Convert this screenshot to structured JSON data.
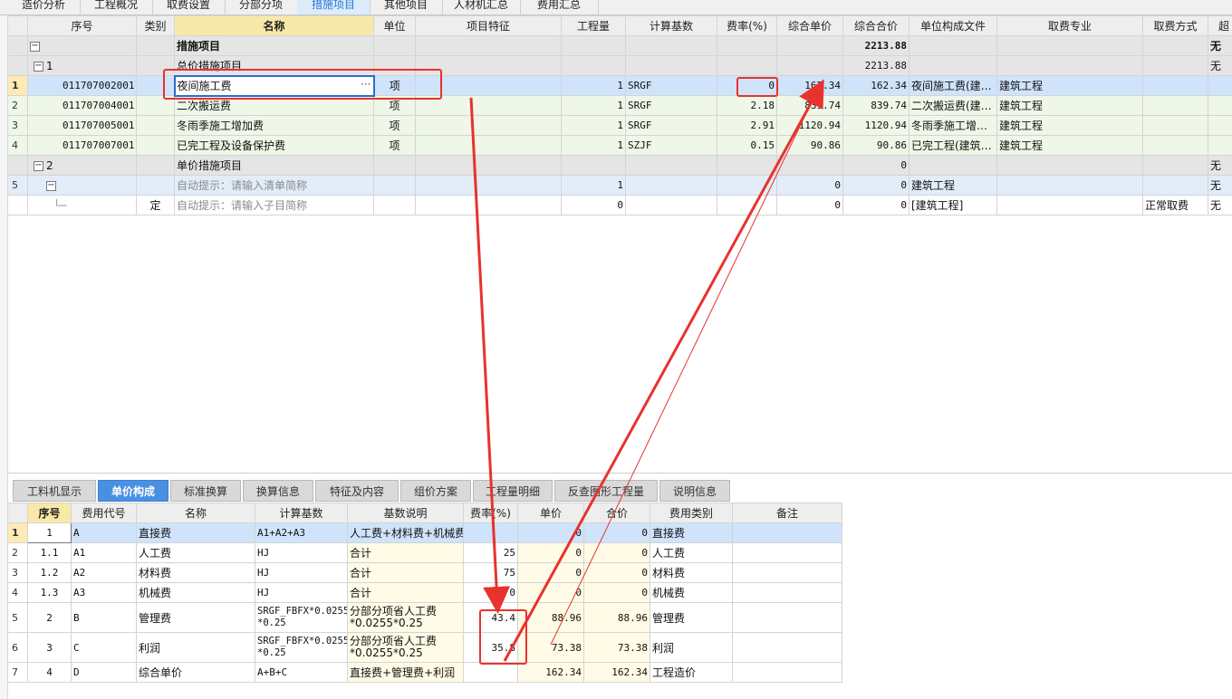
{
  "top_tabs": [
    {
      "label": "造价分析",
      "active": false
    },
    {
      "label": "工程概况",
      "active": false
    },
    {
      "label": "取费设置",
      "active": false
    },
    {
      "label": "分部分项",
      "active": false
    },
    {
      "label": "措施项目",
      "active": true
    },
    {
      "label": "其他项目",
      "active": false
    },
    {
      "label": "人材机汇总",
      "active": false
    },
    {
      "label": "费用汇总",
      "active": false
    }
  ],
  "main_table": {
    "headers": [
      "序号",
      "类别",
      "名称",
      "单位",
      "项目特征",
      "工程量",
      "计算基数",
      "费率(%)",
      "综合单价",
      "综合合价",
      "单位构成文件",
      "取费专业",
      "取费方式",
      "超"
    ],
    "rows": [
      {
        "rownum": "",
        "code": "",
        "type": "",
        "name": "措施项目",
        "unit": "",
        "feature": "",
        "qty": "",
        "base": "",
        "rate": "",
        "price": "",
        "total": "2213.88",
        "file": "",
        "major": "",
        "method": "",
        "extra": "无"
      },
      {
        "rownum": "",
        "code": "1",
        "type": "",
        "name": "总价措施项目",
        "unit": "",
        "feature": "",
        "qty": "",
        "base": "",
        "rate": "",
        "price": "",
        "total": "2213.88",
        "file": "",
        "major": "",
        "method": "",
        "extra": "无"
      },
      {
        "rownum": "1",
        "code": "011707002001",
        "type": "",
        "name": "夜间施工费",
        "unit": "项",
        "feature": "",
        "qty": "1",
        "base": "SRGF",
        "rate": "0",
        "price": "162.34",
        "total": "162.34",
        "file": "夜间施工费(建…",
        "major": "建筑工程",
        "method": "",
        "extra": ""
      },
      {
        "rownum": "2",
        "code": "011707004001",
        "type": "",
        "name": "二次搬运费",
        "unit": "项",
        "feature": "",
        "qty": "1",
        "base": "SRGF",
        "rate": "2.18",
        "price": "839.74",
        "total": "839.74",
        "file": "二次搬运费(建…",
        "major": "建筑工程",
        "method": "",
        "extra": ""
      },
      {
        "rownum": "3",
        "code": "011707005001",
        "type": "",
        "name": "冬雨季施工增加费",
        "unit": "项",
        "feature": "",
        "qty": "1",
        "base": "SRGF",
        "rate": "2.91",
        "price": "1120.94",
        "total": "1120.94",
        "file": "冬雨季施工增…",
        "major": "建筑工程",
        "method": "",
        "extra": ""
      },
      {
        "rownum": "4",
        "code": "011707007001",
        "type": "",
        "name": "已完工程及设备保护费",
        "unit": "项",
        "feature": "",
        "qty": "1",
        "base": "SZJF",
        "rate": "0.15",
        "price": "90.86",
        "total": "90.86",
        "file": "已完工程(建筑…",
        "major": "建筑工程",
        "method": "",
        "extra": ""
      },
      {
        "rownum": "",
        "code": "2",
        "type": "",
        "name": "单价措施项目",
        "unit": "",
        "feature": "",
        "qty": "",
        "base": "",
        "rate": "",
        "price": "",
        "total": "0",
        "file": "",
        "major": "",
        "method": "",
        "extra": "无"
      },
      {
        "rownum": "5",
        "code": "",
        "type": "",
        "name": "自动提示：请输入清单简称",
        "unit": "",
        "feature": "",
        "qty": "1",
        "base": "",
        "rate": "",
        "price": "0",
        "total": "0",
        "file": "建筑工程",
        "major": "",
        "method": "",
        "extra": "无"
      },
      {
        "rownum": "",
        "code": "",
        "type": "定",
        "name": "自动提示：请输入子目简称",
        "unit": "",
        "feature": "",
        "qty": "0",
        "base": "",
        "rate": "",
        "price": "0",
        "total": "0",
        "file": "[建筑工程]",
        "major": "",
        "method": "正常取费",
        "extra": "无"
      }
    ]
  },
  "bottom_tabs": [
    {
      "label": "工料机显示",
      "active": false
    },
    {
      "label": "单价构成",
      "active": true
    },
    {
      "label": "标准换算",
      "active": false
    },
    {
      "label": "换算信息",
      "active": false
    },
    {
      "label": "特征及内容",
      "active": false
    },
    {
      "label": "组价方案",
      "active": false
    },
    {
      "label": "工程量明细",
      "active": false
    },
    {
      "label": "反查图形工程量",
      "active": false
    },
    {
      "label": "说明信息",
      "active": false
    }
  ],
  "sub_table": {
    "headers": [
      "序号",
      "费用代号",
      "名称",
      "计算基数",
      "基数说明",
      "费率(%)",
      "单价",
      "合价",
      "费用类别",
      "备注"
    ],
    "rows": [
      {
        "rownum": "1",
        "seq": "1",
        "code": "A",
        "name": "直接费",
        "base": "A1+A2+A3",
        "desc": "人工费+材料费+机械费",
        "rate": "",
        "price": "0",
        "total": "0",
        "category": "直接费",
        "note": ""
      },
      {
        "rownum": "2",
        "seq": "1.1",
        "code": "A1",
        "name": "人工费",
        "base": "HJ",
        "desc": "合计",
        "rate": "25",
        "price": "0",
        "total": "0",
        "category": "人工费",
        "note": ""
      },
      {
        "rownum": "3",
        "seq": "1.2",
        "code": "A2",
        "name": "材料费",
        "base": "HJ",
        "desc": "合计",
        "rate": "75",
        "price": "0",
        "total": "0",
        "category": "材料费",
        "note": ""
      },
      {
        "rownum": "4",
        "seq": "1.3",
        "code": "A3",
        "name": "机械费",
        "base": "HJ",
        "desc": "合计",
        "rate": "0",
        "price": "0",
        "total": "0",
        "category": "机械费",
        "note": ""
      },
      {
        "rownum": "5",
        "seq": "2",
        "code": "B",
        "name": "管理费",
        "base": "SRGF_FBFX*0.0255 *0.25",
        "desc": "分部分项省人工费 *0.0255*0.25",
        "rate": "43.4",
        "price": "88.96",
        "total": "88.96",
        "category": "管理费",
        "note": ""
      },
      {
        "rownum": "6",
        "seq": "3",
        "code": "C",
        "name": "利润",
        "base": "SRGF_FBFX*0.0255 *0.25",
        "desc": "分部分项省人工费 *0.0255*0.25",
        "rate": "35.8",
        "price": "73.38",
        "total": "73.38",
        "category": "利润",
        "note": ""
      },
      {
        "rownum": "7",
        "seq": "4",
        "code": "D",
        "name": "综合单价",
        "base": "A+B+C",
        "desc": "直接费+管理费+利润",
        "rate": "",
        "price": "162.34",
        "total": "162.34",
        "category": "工程造价",
        "note": ""
      }
    ]
  },
  "colors": {
    "accent": "#4a90e2",
    "annotation": "#e8322d",
    "selected_row": "#cfe3fb"
  }
}
